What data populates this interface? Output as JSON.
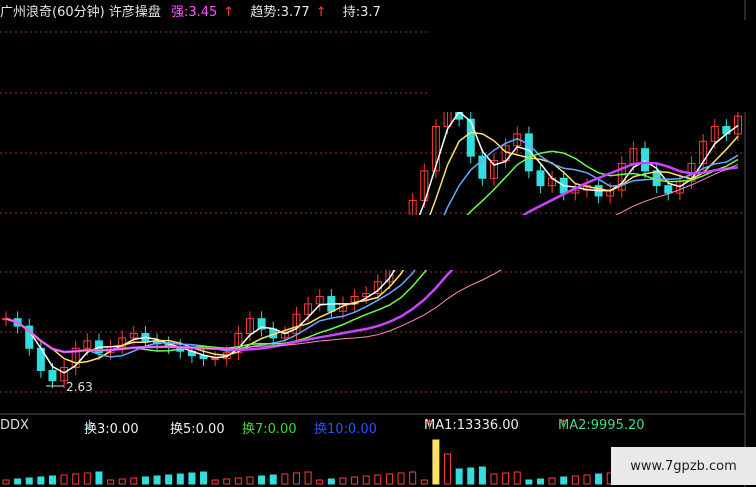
{
  "header": {
    "title": "广州浪奇(60分钟) 许彦操盘",
    "strong_label": "强:3.45",
    "strong_arrow": "↑",
    "trend_label": "趋势:3.77",
    "trend_arrow": "↑",
    "hold_label": "持:3.7"
  },
  "indicator_bar": {
    "name": "DDX",
    "h3": "换3:0.00",
    "h3_arrow": "↓",
    "h5": "换5:0.00",
    "h7": "换7:0.00",
    "h10": "换10:0.00",
    "ma1": "MA1:13336.00",
    "ma1_arrow": "↑",
    "ma2": "MA2:9995.20",
    "ma2_arrow": "↑"
  },
  "low_marker": "2.63",
  "watermark": "www.7gpzb.com",
  "colors": {
    "background": "#000000",
    "grid": "#8b3a1e",
    "up": "#ff3b3b",
    "down": "#33dddd",
    "title": "#e6e6e6",
    "strong": "#ff55ff",
    "ma_white": "#ffffff",
    "ma_yellow": "#ffe066",
    "ma_magenta": "#cc44ff",
    "ma_pink": "#ff88cc",
    "ma_green": "#66ff44",
    "ma_sky": "#66aaff",
    "h7_color": "#33dd33",
    "h10_color": "#2255ff",
    "ma2_color": "#44dd88"
  },
  "chart_data": {
    "type": "line",
    "title": "广州浪奇(60分钟)",
    "y_low_label": "2.63",
    "series": [
      {
        "name": "close",
        "values": [
          3.05,
          3.0,
          2.85,
          2.7,
          2.63,
          2.72,
          2.85,
          2.9,
          2.82,
          2.86,
          2.92,
          2.95,
          2.9,
          2.88,
          2.86,
          2.83,
          2.8,
          2.78,
          2.78,
          2.82,
          2.95,
          3.05,
          2.98,
          2.92,
          2.95,
          3.08,
          3.15,
          3.2,
          3.1,
          3.15,
          3.2,
          3.22,
          3.3,
          3.45,
          3.6,
          3.85,
          4.05,
          4.35,
          4.6,
          4.4,
          4.15,
          4.0,
          4.12,
          4.22,
          4.3,
          4.05,
          3.95,
          4.0,
          3.9,
          3.92,
          3.95,
          3.88,
          3.92,
          4.1,
          4.2,
          4.05,
          3.95,
          3.9,
          3.98,
          4.1,
          4.25,
          4.35,
          4.3,
          4.42
        ]
      }
    ],
    "grid": true
  }
}
